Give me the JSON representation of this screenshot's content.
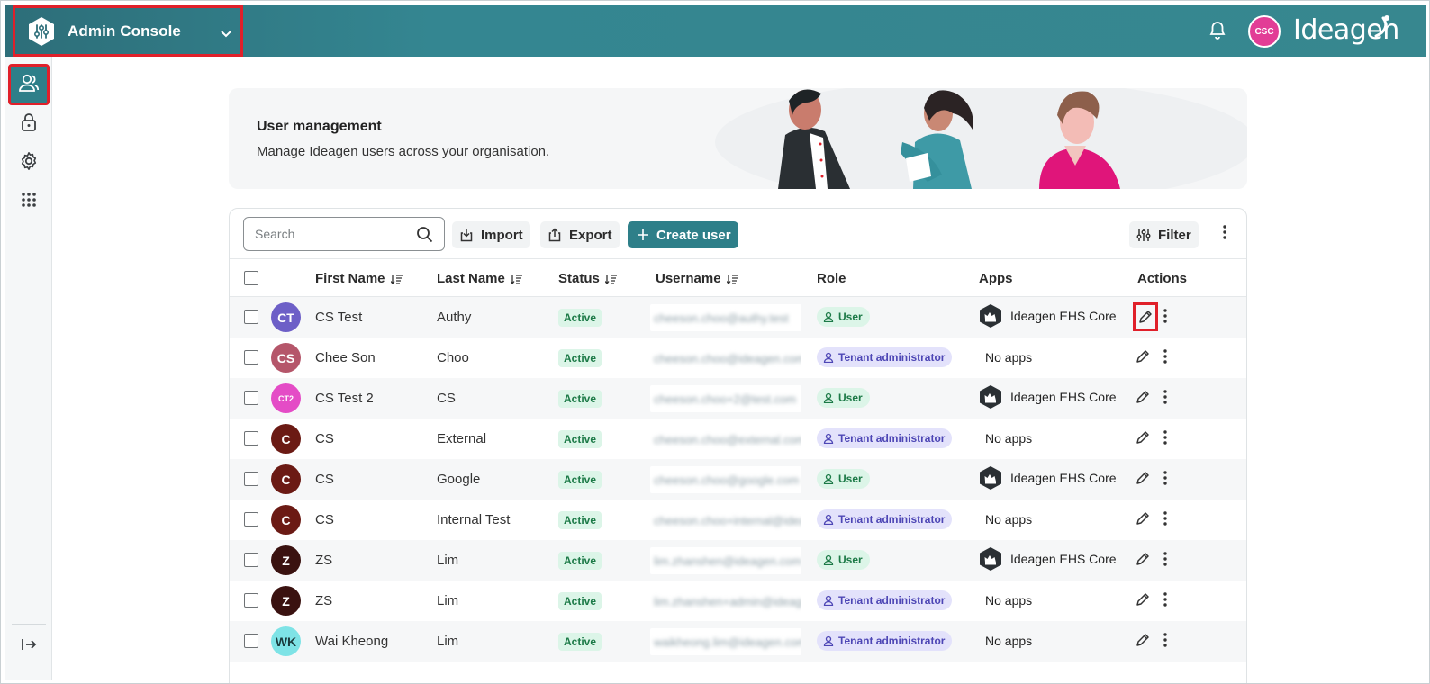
{
  "app": {
    "title": "Admin Console",
    "brand": "Ideagen",
    "user_initials": "CSC"
  },
  "banner": {
    "title": "User management",
    "subtitle": "Manage Ideagen users across your organisation."
  },
  "toolbar": {
    "search_placeholder": "Search",
    "import_label": "Import",
    "export_label": "Export",
    "create_label": "Create user",
    "filter_label": "Filter"
  },
  "table": {
    "headers": {
      "first_name": "First Name",
      "last_name": "Last Name",
      "status": "Status",
      "username": "Username",
      "role": "Role",
      "apps": "Apps",
      "actions": "Actions"
    },
    "rows": [
      {
        "initials": "CT",
        "avatar_color": "#6d5fc7",
        "first": "CS Test",
        "last": "Authy",
        "status": "Active",
        "username": "cheeson.choo@authy.test",
        "role": "User",
        "app": "Ideagen EHS Core"
      },
      {
        "initials": "CS",
        "avatar_color": "#b5566a",
        "first": "Chee Son",
        "last": "Choo",
        "status": "Active",
        "username": "cheeson.choo@ideagen.com",
        "role": "Tenant administrator",
        "app": "No apps"
      },
      {
        "initials": "CT2",
        "avatar_color": "#e44cc6",
        "first": "CS Test 2",
        "last": "CS",
        "status": "Active",
        "username": "cheeson.choo+2@test.com",
        "role": "User",
        "app": "Ideagen EHS Core"
      },
      {
        "initials": "C",
        "avatar_color": "#6b1a14",
        "first": "CS",
        "last": "External",
        "status": "Active",
        "username": "cheeson.choo@external.com",
        "role": "Tenant administrator",
        "app": "No apps"
      },
      {
        "initials": "C",
        "avatar_color": "#6b1a14",
        "first": "CS",
        "last": "Google",
        "status": "Active",
        "username": "cheeson.choo@google.com",
        "role": "User",
        "app": "Ideagen EHS Core"
      },
      {
        "initials": "C",
        "avatar_color": "#6b1a14",
        "first": "CS",
        "last": "Internal Test",
        "status": "Active",
        "username": "cheeson.choo+internal@ideagen",
        "role": "Tenant administrator",
        "app": "No apps"
      },
      {
        "initials": "Z",
        "avatar_color": "#3a1210",
        "first": "ZS",
        "last": "Lim",
        "status": "Active",
        "username": "lim.zhanshen@ideagen.com",
        "role": "User",
        "app": "Ideagen EHS Core"
      },
      {
        "initials": "Z",
        "avatar_color": "#3a1210",
        "first": "ZS",
        "last": "Lim",
        "status": "Active",
        "username": "lim.zhanshen+admin@ideagen",
        "role": "Tenant administrator",
        "app": "No apps"
      },
      {
        "initials": "WK",
        "avatar_color": "#7ee3e6",
        "first": "Wai Kheong",
        "last": "Lim",
        "status": "Active",
        "username": "waikheong.lim@ideagen.com",
        "role": "Tenant administrator",
        "app": "No apps"
      }
    ]
  },
  "colors": {
    "primary": "#2e7f89",
    "highlight": "#e0202a"
  }
}
